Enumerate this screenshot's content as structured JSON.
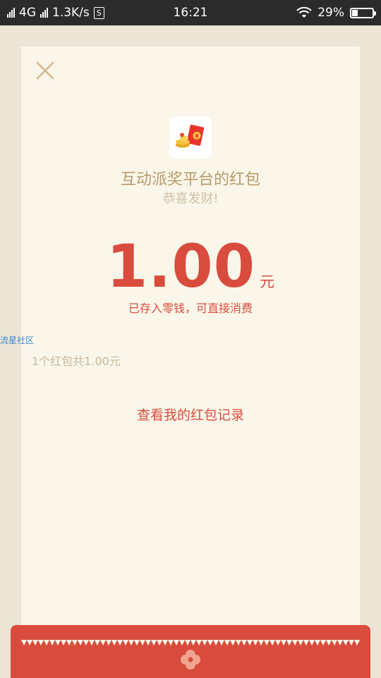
{
  "status_bar": {
    "network": "4G",
    "speed": "1.3K/s",
    "s_badge": "S",
    "time": "16:21",
    "battery": "29%",
    "battery_level": 0.29
  },
  "packet": {
    "title": "互动派奖平台的红包",
    "greeting": "恭喜发财!",
    "amount": "1.00",
    "unit": "元",
    "note": "已存入零钱，可直接消费",
    "count_text": "1个红包共1.00元",
    "record_link": "查看我的红包记录"
  },
  "watermark": "流星社区",
  "icons": {
    "close": "close-icon",
    "app": "red-envelope-app-icon",
    "flower": "flower-icon"
  },
  "colors": {
    "background": "#ede6d6",
    "card": "#fbf6ea",
    "accent_red": "#d94c3d",
    "gold_text": "#b69a6c",
    "muted_text": "#cfc1a8"
  }
}
